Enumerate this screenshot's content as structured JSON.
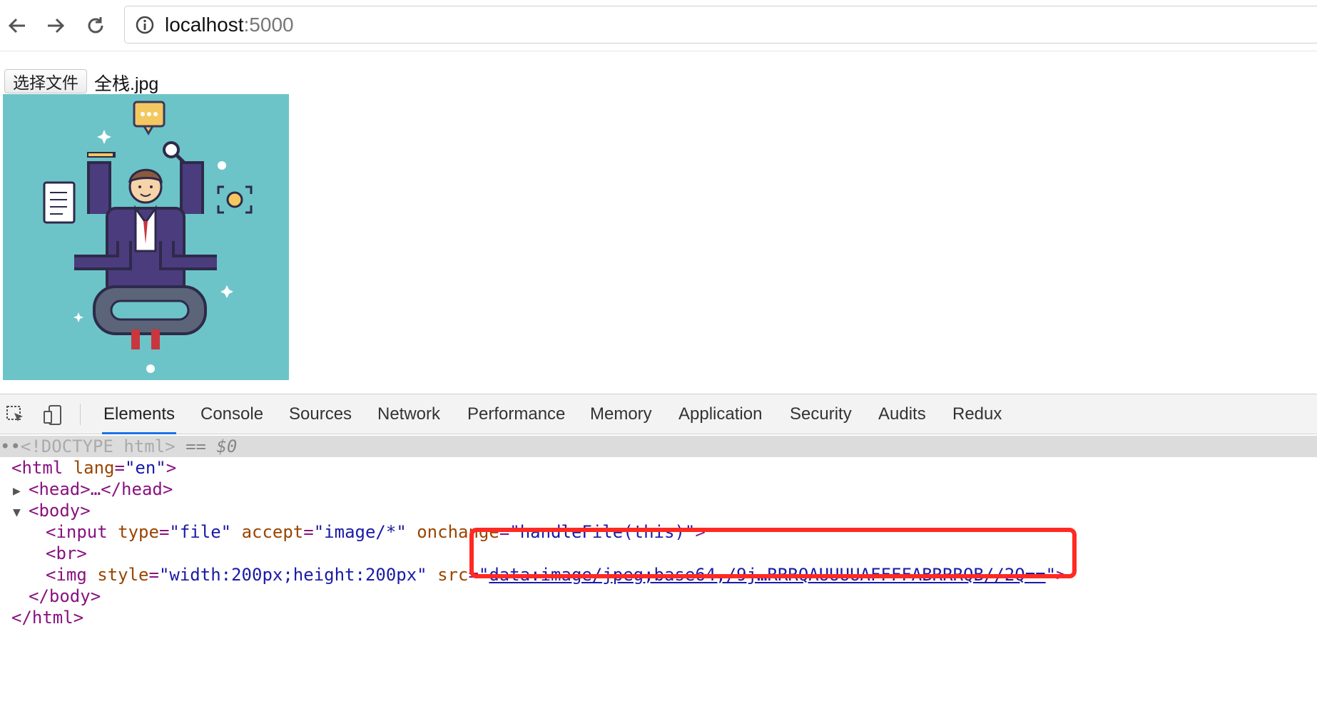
{
  "browser": {
    "url_host": "localhost",
    "url_port": ":5000"
  },
  "page": {
    "file_button_label": "选择文件",
    "file_name": "全栈.jpg"
  },
  "devtools": {
    "tabs": [
      "Elements",
      "Console",
      "Sources",
      "Network",
      "Performance",
      "Memory",
      "Application",
      "Security",
      "Audits",
      "Redux"
    ],
    "active_tab": "Elements",
    "dom": {
      "doctype": "<!DOCTYPE html>",
      "selected_marker": "== $0",
      "html_open": "<html",
      "html_attr": "lang",
      "html_val": "\"en\"",
      "head": "<head>…</head>",
      "body_open": "<body>",
      "input_tag": "<input",
      "input_type_attr": "type",
      "input_type_val": "\"file\"",
      "input_accept_attr": "accept",
      "input_accept_val": "\"image/*\"",
      "input_onchange_attr": "onchange",
      "input_onchange_val": "\"handleFile(this)\"",
      "br": "<br>",
      "img_tag": "<img",
      "img_style_attr": "style",
      "img_style_val": "\"width:200px;height:200px\"",
      "img_src_attr": "src",
      "img_src_val": "data:image/jpeg;base64,/9j…RRRQAUUUUAFFFFABRRRQB//2Q==",
      "body_close": "</body>",
      "html_close": "</html>"
    },
    "colors": {
      "highlight": "#ff2a22",
      "active_tab": "#1a73e8"
    }
  }
}
